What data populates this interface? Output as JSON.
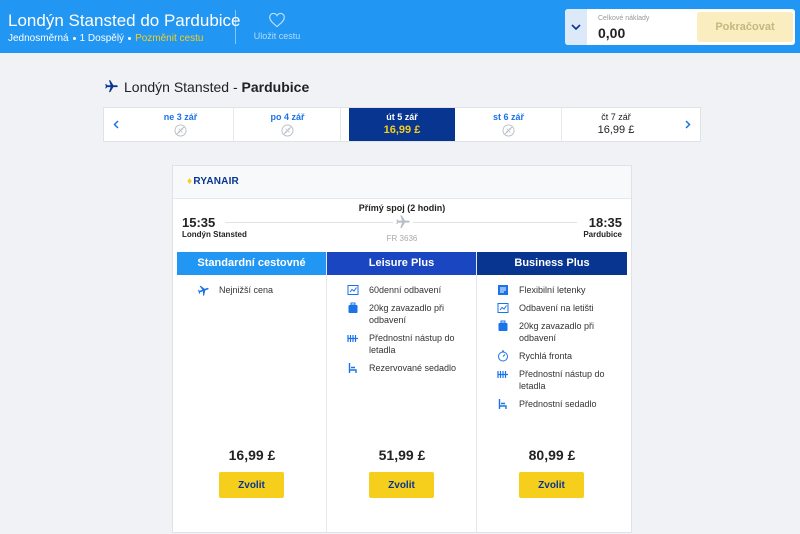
{
  "header": {
    "title": "Londýn Stansted do Pardubice",
    "trip_type": "Jednosměrná",
    "passengers": "1 Dospělý",
    "change_trip": "Pozměnit cestu",
    "save_trip": "Uložit cestu",
    "total_cost_label": "Celkové náklady",
    "total_cost_value": "0,00",
    "continue_label": "Pokračovat"
  },
  "route": {
    "origin": "Londýn Stansted",
    "separator": " - ",
    "destination": "Pardubice"
  },
  "dates": [
    {
      "label": "ne 3 zář",
      "price": "",
      "state": "no-flight"
    },
    {
      "label": "po 4 zář",
      "price": "",
      "state": "no-flight"
    },
    {
      "label": "út 5 zář",
      "price": "16,99 £",
      "state": "selected"
    },
    {
      "label": "st 6 zář",
      "price": "",
      "state": "no-flight"
    },
    {
      "label": "čt 7 zář",
      "price": "16,99 £",
      "state": "available"
    }
  ],
  "flight": {
    "airline": "RYANAIR",
    "type": "Přímý spoj (2 hodin)",
    "departure_time": "15:35",
    "departure_city": "Londýn Stansted",
    "arrival_time": "18:35",
    "arrival_city": "Pardubice",
    "flight_number": "FR 3636"
  },
  "fares": [
    {
      "name": "Standardní cestovné",
      "features": [
        {
          "icon": "plane-icon",
          "text": "Nejnižší cena"
        }
      ],
      "price": "16,99 £",
      "button": "Zvolit"
    },
    {
      "name": "Leisure Plus",
      "features": [
        {
          "icon": "checkin-icon",
          "text": "60denní odbavení"
        },
        {
          "icon": "baggage-icon",
          "text": "20kg zavazadlo při odbavení"
        },
        {
          "icon": "priority-boarding-icon",
          "text": "Přednostní nástup do letadla"
        },
        {
          "icon": "seat-icon",
          "text": "Rezervované sedadlo"
        }
      ],
      "price": "51,99 £",
      "button": "Zvolit"
    },
    {
      "name": "Business Plus",
      "features": [
        {
          "icon": "flexible-ticket-icon",
          "text": "Flexibilní letenky"
        },
        {
          "icon": "checkin-icon",
          "text": "Odbavení na letišti"
        },
        {
          "icon": "baggage-icon",
          "text": "20kg zavazadlo při odbavení"
        },
        {
          "icon": "fast-track-icon",
          "text": "Rychlá fronta"
        },
        {
          "icon": "priority-boarding-icon",
          "text": "Přednostní nástup do letadla"
        },
        {
          "icon": "seat-icon",
          "text": "Přednostní sedadlo"
        }
      ],
      "price": "80,99 £",
      "button": "Zvolit"
    }
  ],
  "colors": {
    "header_blue": "#2196f3",
    "ryanair_navy": "#073590",
    "ryanair_yellow": "#f6cf1c",
    "leisure_blue": "#1a46c2"
  }
}
